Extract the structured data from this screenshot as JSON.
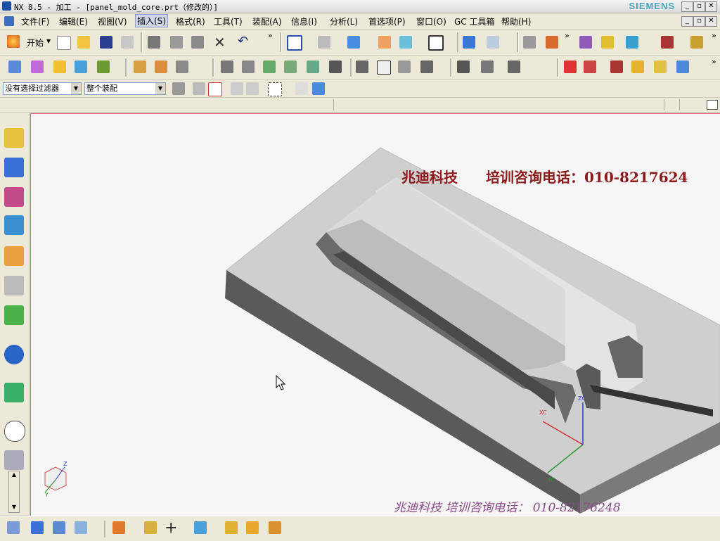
{
  "window": {
    "title": "NX 8.5 - 加工 - [panel_mold_core.prt（修改的）]",
    "brand": "SIEMENS",
    "controls": [
      "_",
      "▫",
      "✕"
    ],
    "child_controls": [
      "_",
      "▫",
      "✕"
    ]
  },
  "menu": {
    "items": [
      "文件(F)",
      "编辑(E)",
      "视图(V)",
      "插入(S)",
      "格式(R)",
      "工具(T)",
      "装配(A)",
      "信息(I)",
      "分析(L)",
      "首选项(P)",
      "窗口(O)",
      "GC 工具箱",
      "帮助(H)"
    ],
    "active_index": 3
  },
  "toolbar": {
    "start_label": "开始",
    "overflow": "»"
  },
  "selection": {
    "filter_value": "没有选择过滤器",
    "scope_value": "整个装配"
  },
  "viewport": {
    "watermark_top_left": "兆迪科技",
    "watermark_top_right": "培训咨询电话：010-8217624",
    "watermark_bottom": "兆迪科技 培训咨询电话： 010-82176248",
    "axis_labels": {
      "zc": "ZC",
      "yc": "YC",
      "xc": "XC",
      "triad_z": "Z",
      "triad_y": "Y"
    },
    "colors": {
      "x_axis": "#d23030",
      "y_axis": "#2a9a2a",
      "z_axis": "#2a3ad0",
      "frame": "#e06a6a"
    }
  },
  "icons": {
    "sidebar": [
      "assembly-navigator-icon",
      "constraint-navigator-icon",
      "part-navigator-icon",
      "operation-navigator-icon",
      "reuse-library-icon",
      "web-browser-icon",
      "history-icon",
      "info-icon",
      "globe-icon",
      "clock-icon",
      "book-icon"
    ]
  }
}
